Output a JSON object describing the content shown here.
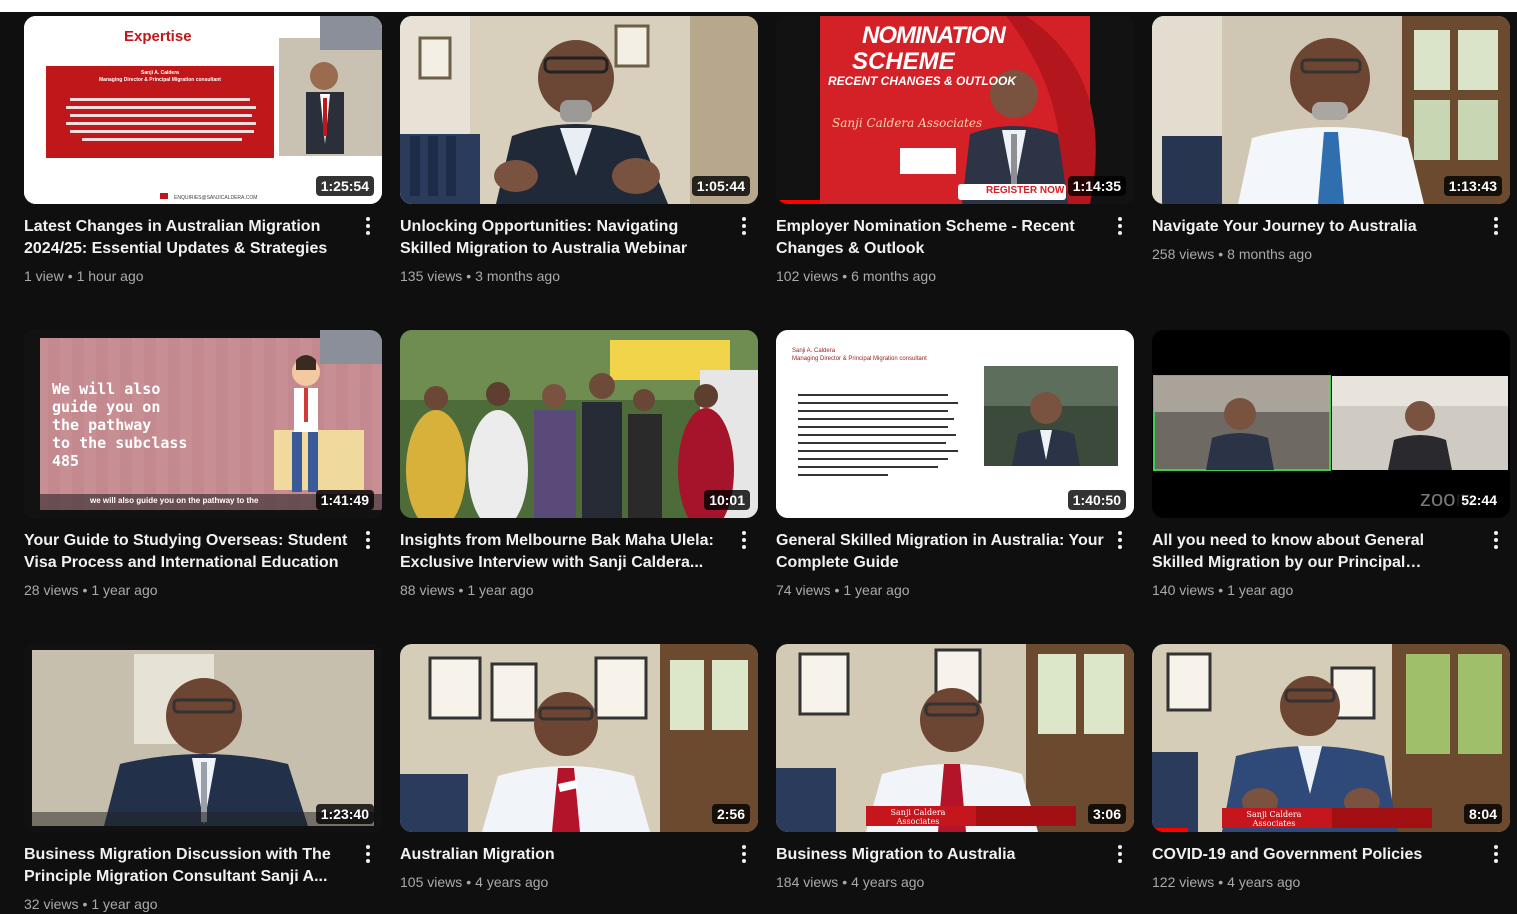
{
  "videos": [
    {
      "title": "Latest Changes in Australian Migration 2024/25: Essential Updates & Strategies",
      "views": "1 view",
      "age": "1 hour ago",
      "duration": "1:25:54",
      "thumb": {
        "heading": "Expertise",
        "name": "Sanji A. Caldera",
        "role": "Managing Director & Principal Migration consultant",
        "footer": "ENQUIRIES@SANJICALDERA.COM"
      }
    },
    {
      "title": "Unlocking Opportunities: Navigating Skilled Migration to Australia Webinar",
      "views": "135 views",
      "age": "3 months ago",
      "duration": "1:05:44"
    },
    {
      "title": "Employer Nomination Scheme - Recent Changes & Outlook",
      "views": "102 views",
      "age": "6 months ago",
      "duration": "1:14:35",
      "thumb": {
        "line1": "NOMINATION",
        "line2": "SCHEME",
        "line3": "RECENT CHANGES & OUTLOOK",
        "script": "Sanji Caldera Associates",
        "cta": "REGISTER NOW !"
      },
      "progress": 0.12
    },
    {
      "title": "Navigate Your Journey to Australia",
      "views": "258 views",
      "age": "8 months ago",
      "duration": "1:13:43"
    },
    {
      "title": "Your Guide to Studying Overseas: Student Visa Process and International Education",
      "views": "28 views",
      "age": "1 year ago",
      "duration": "1:41:49",
      "thumb": {
        "l1": "We will also",
        "l2": "guide you on",
        "l3": "the pathway",
        "l4": "to the subclass",
        "l5": "485",
        "subtitle": "we will also guide you on the pathway to the"
      }
    },
    {
      "title": "Insights from Melbourne Bak Maha Ulela: Exclusive Interview with Sanji Caldera...",
      "views": "88 views",
      "age": "1 year ago",
      "duration": "10:01"
    },
    {
      "title": "General Skilled Migration in Australia: Your Complete Guide",
      "views": "74 views",
      "age": "1 year ago",
      "duration": "1:40:50",
      "thumb": {
        "name": "Sanji A. Caldera",
        "role": "Managing Director & Principal Migration consultant"
      }
    },
    {
      "title": "All you need to know about General Skilled Migration by our Principal Consultant Sanji...",
      "views": "140 views",
      "age": "1 year ago",
      "duration": "52:44",
      "thumb": {
        "mark": "zoom"
      }
    },
    {
      "title": "Business Migration Discussion with The Principle Migration Consultant Sanji A...",
      "views": "32 views",
      "age": "1 year ago",
      "duration": "1:23:40"
    },
    {
      "title": "Australian Migration",
      "views": "105 views",
      "age": "4 years ago",
      "duration": "2:56"
    },
    {
      "title": "Business Migration to Australia",
      "views": "184 views",
      "age": "4 years ago",
      "duration": "3:06",
      "thumb": {
        "banner": "Sanji Caldera Associates"
      }
    },
    {
      "title": "COVID-19 and Government Policies",
      "views": "122 views",
      "age": "4 years ago",
      "duration": "8:04",
      "thumb": {
        "banner": "Sanji Caldera Associates"
      },
      "progress": 0.1
    }
  ],
  "separator": "•",
  "icons": {
    "menu": "more-vert-icon"
  },
  "colors": {
    "background": "#0f0f0f",
    "title": "#f1f1f1",
    "meta": "#aaaaaa",
    "accent": "#ff0000"
  }
}
